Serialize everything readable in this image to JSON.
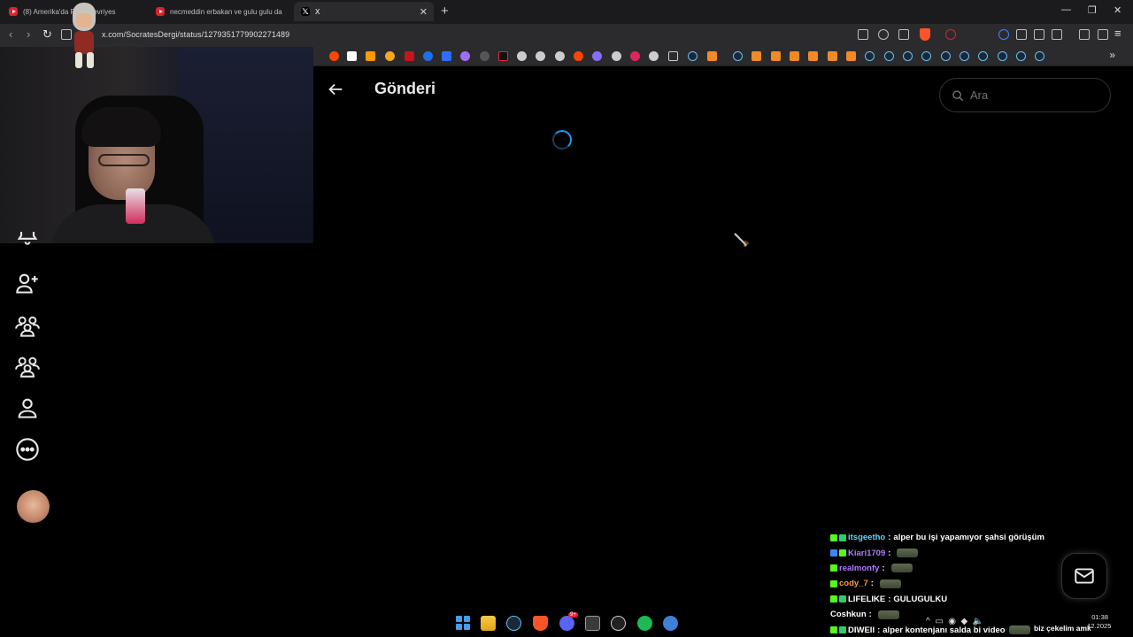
{
  "browser": {
    "tabs": [
      {
        "title": "(8) Amerika'da P... e Devriyes",
        "icon": "youtube-icon",
        "active": false
      },
      {
        "title": "necmeddin erbakan ve gulu gulu da",
        "icon": "youtube-icon",
        "active": false
      },
      {
        "title": "X",
        "icon": "x-logo-icon",
        "active": true
      }
    ],
    "url": "x.com/SocratesDergi/status/1279351779902271489",
    "accent_color": "#fb542b"
  },
  "x": {
    "page_title": "Gönderi",
    "search_placeholder": "Ara",
    "loading": true,
    "accent_color": "#1d9bf0",
    "sidebar_icons": [
      "notifications-icon",
      "follow-icon",
      "communities-icon",
      "communities-icon",
      "profile-icon",
      "more-icon"
    ]
  },
  "chat": {
    "messages": [
      {
        "user": "itsgeetho",
        "user_color": "#5fd3ff",
        "badges": [
          "k",
          "g"
        ],
        "text": "alper bu işi yapamıyor şahsi görüşüm",
        "emote": false
      },
      {
        "user": "Kiari1709",
        "user_color": "#b07cff",
        "badges": [
          "b",
          "k"
        ],
        "text": "",
        "emote": true
      },
      {
        "user": "realmonfy",
        "user_color": "#b07cff",
        "badges": [
          "k"
        ],
        "text": "",
        "emote": true
      },
      {
        "user": "cody_7",
        "user_color": "#ff9a3c",
        "badges": [
          "k"
        ],
        "text": "",
        "emote": true
      },
      {
        "user": "LIFELIKE",
        "user_color": "#ffffff",
        "badges": [
          "k",
          "g"
        ],
        "text": "GULUGULKU",
        "emote": false
      },
      {
        "user": "Coshkun",
        "user_color": "#ffffff",
        "badges": [],
        "text": "",
        "emote": true
      },
      {
        "user": "DIWEII",
        "user_color": "#ffffff",
        "badges": [
          "k",
          "g"
        ],
        "text": "alper kontenjanı salda bi video",
        "emote": true
      }
    ]
  },
  "overlay_text": {
    "bottom_right": "biz çekelim amk"
  },
  "taskbar": {
    "discord_badge": "9+",
    "clock_time": "01:38",
    "clock_date": "...12.2025"
  }
}
